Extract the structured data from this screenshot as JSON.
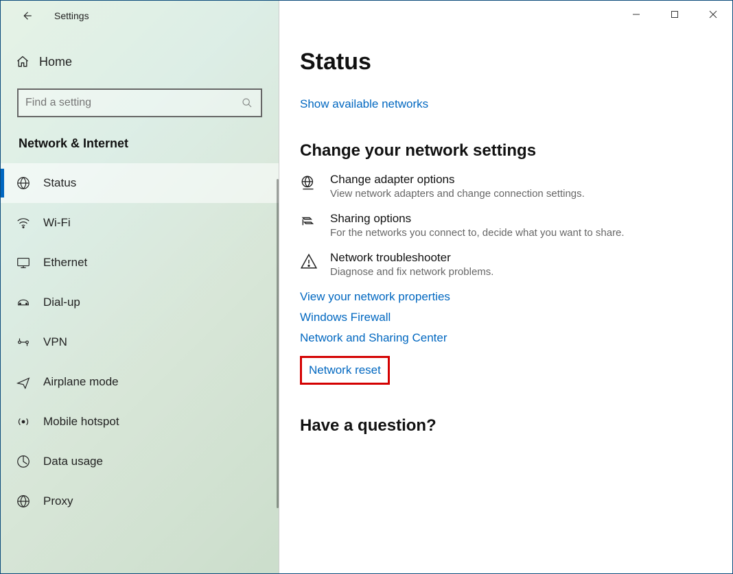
{
  "window": {
    "title": "Settings"
  },
  "sidebar": {
    "home_label": "Home",
    "search_placeholder": "Find a setting",
    "category": "Network & Internet",
    "items": [
      {
        "label": "Status"
      },
      {
        "label": "Wi-Fi"
      },
      {
        "label": "Ethernet"
      },
      {
        "label": "Dial-up"
      },
      {
        "label": "VPN"
      },
      {
        "label": "Airplane mode"
      },
      {
        "label": "Mobile hotspot"
      },
      {
        "label": "Data usage"
      },
      {
        "label": "Proxy"
      }
    ]
  },
  "main": {
    "title": "Status",
    "link_show_networks": "Show available networks",
    "section_change": "Change your network settings",
    "options": [
      {
        "title": "Change adapter options",
        "desc": "View network adapters and change connection settings."
      },
      {
        "title": "Sharing options",
        "desc": "For the networks you connect to, decide what you want to share."
      },
      {
        "title": "Network troubleshooter",
        "desc": "Diagnose and fix network problems."
      }
    ],
    "link_properties": "View your network properties",
    "link_firewall": "Windows Firewall",
    "link_sharing_center": "Network and Sharing Center",
    "link_reset": "Network reset",
    "section_question": "Have a question?"
  }
}
